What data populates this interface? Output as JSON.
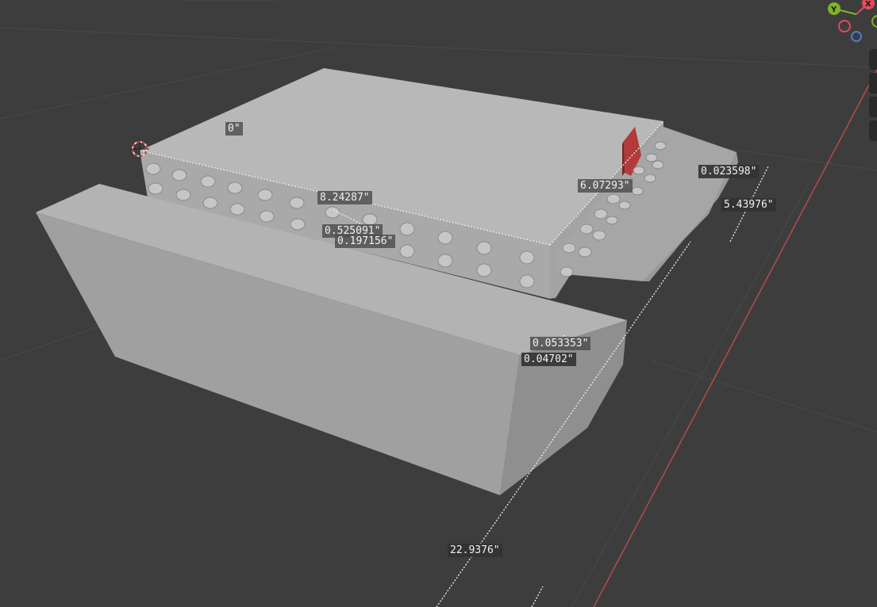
{
  "viewport": {
    "background": "#3d3d3d",
    "grid_color": "#4a4a4a",
    "x_axis_color": "#b84a4a",
    "model_colors": {
      "top": "#b6b6b6",
      "side": "#a4a4a4",
      "shadow": "#8e8e8e",
      "part": "#b33a3a"
    }
  },
  "gizmo": {
    "x_label": "X",
    "y_label": "Y",
    "colors": {
      "x": "#e04b5c",
      "y": "#7db52a",
      "z": "#4a7bd6"
    }
  },
  "measurements": [
    {
      "id": "zero",
      "text": "0\""
    },
    {
      "id": "m1",
      "text": "8.24287\""
    },
    {
      "id": "m2",
      "text": "0.525091\""
    },
    {
      "id": "m3",
      "text": "0.197156\""
    },
    {
      "id": "m4",
      "text": "6.07293\""
    },
    {
      "id": "m5",
      "text": "0.023598\""
    },
    {
      "id": "m6",
      "text": "5.43976\""
    },
    {
      "id": "m7",
      "text": "0.053353\""
    },
    {
      "id": "m8",
      "text": "0.04702\""
    },
    {
      "id": "m9",
      "text": "22.9376\""
    }
  ],
  "side_tools": [
    "zoom-icon",
    "pan-icon",
    "camera-icon",
    "perspective-icon"
  ]
}
